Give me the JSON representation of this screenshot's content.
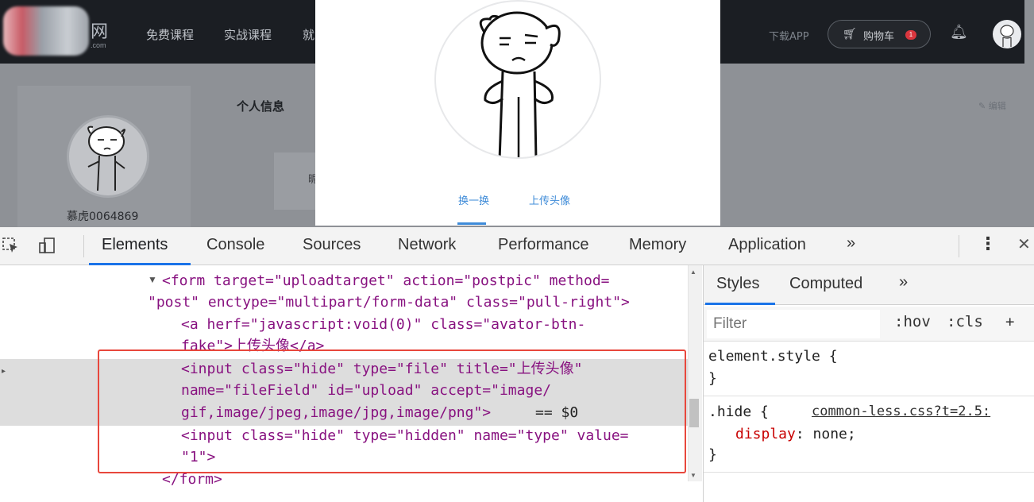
{
  "site": {
    "logo_suffix": "网",
    "logo_sub": ".com",
    "nav": [
      "免费课程",
      "实战课程",
      "就"
    ],
    "download": "下载APP",
    "cart_label": "购物车",
    "cart_count": "1",
    "section_title": "个人信息",
    "edit_label": "编辑",
    "username": "慕虎0064869",
    "ghost_char": "昵"
  },
  "modal": {
    "change_label": "换一换",
    "upload_label": "上传头像"
  },
  "devtools": {
    "tabs": [
      "Elements",
      "Console",
      "Sources",
      "Network",
      "Performance",
      "Memory",
      "Application"
    ],
    "active_tab": "Elements",
    "more": "»",
    "styles_tabs": [
      "Styles",
      "Computed"
    ],
    "filter_placeholder": "Filter",
    "hov": ":hov",
    "cls": ":cls",
    "plus": "+",
    "dom": {
      "form_open_1": "<form target=\"uploadtarget\" action=\"postpic\" method=",
      "form_open_2": "\"post\" enctype=\"multipart/form-data\" class=\"pull-right\">",
      "a_line_1": "<a herf=\"javascript:void(0)\" class=\"avator-btn-",
      "a_line_2": "fake\">上传头像</a>",
      "input1_line_1": "<input class=\"hide\" type=\"file\" title=\"上传头像\"",
      "input1_line_2": "name=\"fileField\" id=\"upload\" accept=\"image/",
      "input1_line_3": "gif,image/jpeg,image/jpg,image/png\">",
      "selected_marker": "== $0",
      "input2_line_1": "<input class=\"hide\" type=\"hidden\" name=\"type\" value=",
      "input2_line_2": "\"1\">",
      "form_close": "</form>"
    },
    "styles": {
      "element_style": "element.style {",
      "close_brace": "}",
      "rule_selector": ".hide {",
      "rule_source": "common-less.css?t=2.5:",
      "rule_prop": "display",
      "rule_value": ": none;"
    }
  }
}
